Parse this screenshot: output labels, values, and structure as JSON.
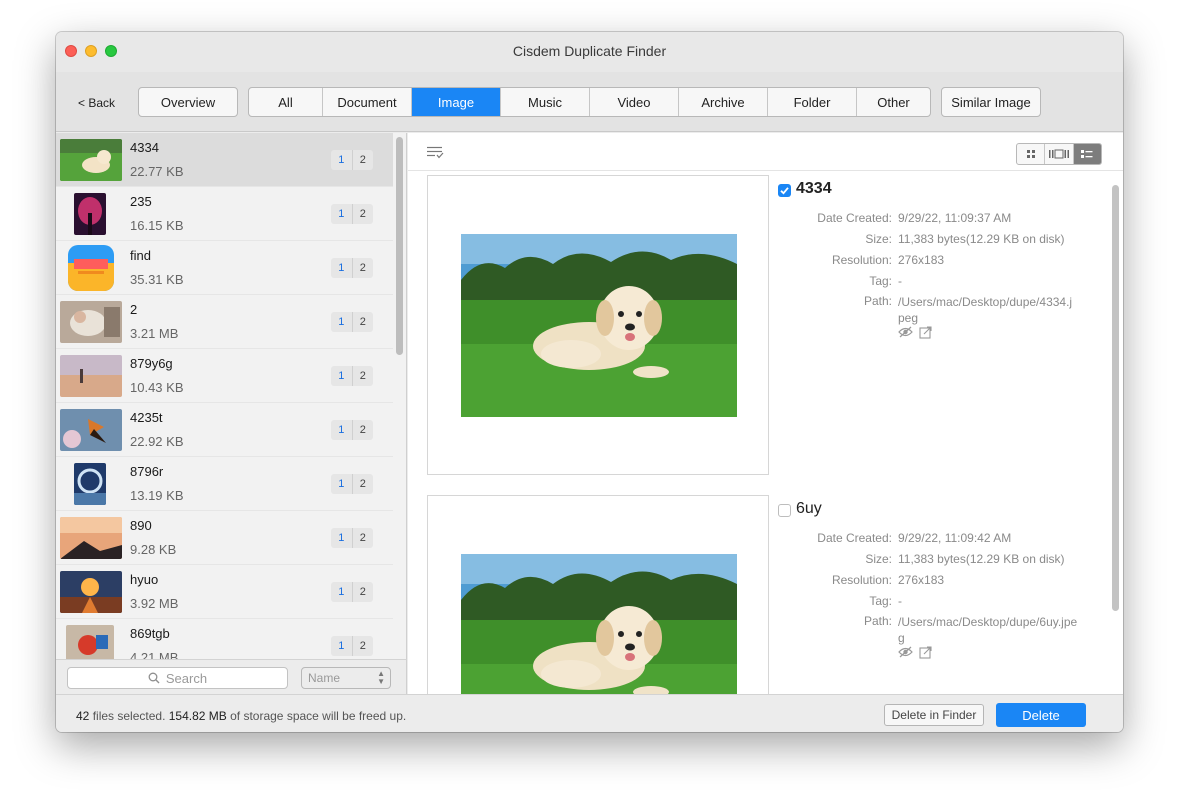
{
  "window": {
    "title": "Cisdem Duplicate Finder"
  },
  "toolbar": {
    "back_label": "< Back",
    "overview_label": "Overview",
    "tabs": [
      {
        "label": "All"
      },
      {
        "label": "Document"
      },
      {
        "label": "Image",
        "active": true
      },
      {
        "label": "Music"
      },
      {
        "label": "Video"
      },
      {
        "label": "Archive"
      },
      {
        "label": "Folder"
      },
      {
        "label": "Other"
      }
    ],
    "similar_label": "Similar Image"
  },
  "sidebar": {
    "items": [
      {
        "name": "4334",
        "size": "22.77 KB",
        "count_a": "1",
        "count_b": "2",
        "thumb": "dog"
      },
      {
        "name": "235",
        "size": "16.15 KB",
        "count_a": "1",
        "count_b": "2",
        "thumb": "tree"
      },
      {
        "name": "find",
        "size": "35.31 KB",
        "count_a": "1",
        "count_b": "2",
        "thumb": "app-icon"
      },
      {
        "name": "2",
        "size": "3.21 MB",
        "count_a": "1",
        "count_b": "2",
        "thumb": "hands"
      },
      {
        "name": "879y6g",
        "size": "10.43 KB",
        "count_a": "1",
        "count_b": "2",
        "thumb": "beach"
      },
      {
        "name": "4235t",
        "size": "22.92 KB",
        "count_a": "1",
        "count_b": "2",
        "thumb": "butterfly"
      },
      {
        "name": "8796r",
        "size": "13.19 KB",
        "count_a": "1",
        "count_b": "2",
        "thumb": "portal"
      },
      {
        "name": "890",
        "size": "9.28 KB",
        "count_a": "1",
        "count_b": "2",
        "thumb": "dusk"
      },
      {
        "name": "hyuo",
        "size": "3.92 MB",
        "count_a": "1",
        "count_b": "2",
        "thumb": "sunset"
      },
      {
        "name": "869tgb",
        "size": "4.21 MB",
        "count_a": "1",
        "count_b": "2",
        "thumb": "toys"
      }
    ],
    "search_placeholder": "Search",
    "sort_value": "Name"
  },
  "detail": {
    "labels": {
      "date": "Date Created:",
      "size": "Size:",
      "resolution": "Resolution:",
      "tag": "Tag:",
      "path": "Path:"
    },
    "files": [
      {
        "name": "4334",
        "checked": true,
        "date": "9/29/22, 11:09:37 AM",
        "size": "11,383 bytes(12.29 KB on disk)",
        "resolution": "276x183",
        "tag": "-",
        "path": "/Users/mac/Desktop/dupe/4334.jpeg"
      },
      {
        "name": "6uy",
        "checked": false,
        "date": "9/29/22, 11:09:42 AM",
        "size": "11,383 bytes(12.29 KB on disk)",
        "resolution": "276x183",
        "tag": "-",
        "path": "/Users/mac/Desktop/dupe/6uy.jpeg"
      }
    ]
  },
  "status": {
    "count": "42",
    "count_suffix": " files selected. ",
    "freed": "154.82 MB",
    "freed_suffix": " of storage space will be freed up.",
    "delete_in_finder_label": "Delete in Finder",
    "delete_label": "Delete"
  },
  "colors": {
    "accent": "#1a86f5"
  }
}
